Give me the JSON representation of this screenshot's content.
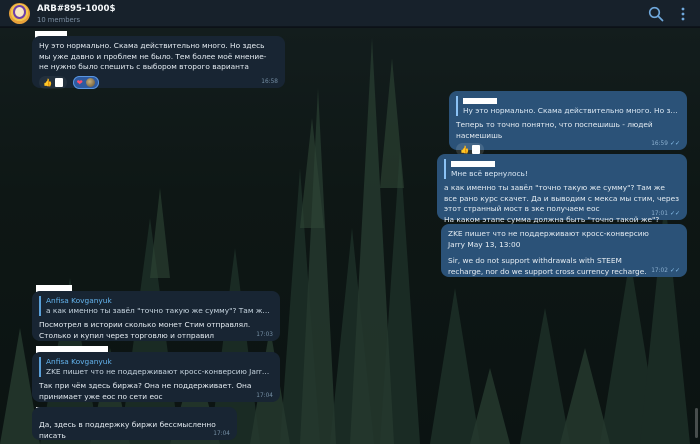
{
  "header": {
    "title": "ARB#895-1000$",
    "members": "10 members"
  },
  "colors": {
    "header_bg": "#17212b",
    "incoming_bubble": "#182533",
    "outgoing_bubble": "#2b5278",
    "quote_accent": "#64b5ef"
  },
  "icons": {
    "search": "search-icon",
    "more": "more-vertical-icon"
  },
  "messages": [
    {
      "direction": "in",
      "text": "Ну это нормально. Скама действительно много. Но здесь мы уже давно и проблем не было. Тем более моё мнение- не нужно было спешить с выбором второго варианта",
      "time": "16:58",
      "reactions": [
        "👍",
        "❤"
      ]
    },
    {
      "direction": "out",
      "quote_text": "Ну это нормально. Скама действительно много. Но здесь мы...",
      "text": "Теперь то точно понятно, что поспешишь - людей насмешишь",
      "time": "16:59",
      "reactions": [
        "👍"
      ]
    },
    {
      "direction": "out",
      "quote_text": "Мне всё вернулось!",
      "text": "а как именно ты завёл \"точно такую же сумму\"? Там же все рано курс скачет. Да и выводим с мекса мы стим, через этот странный мост в зке получаем еос",
      "text2": "На каком этапе сумма должна быть \"точно такой же\"?",
      "time": "17:01"
    },
    {
      "direction": "out",
      "text": "ZKE пишет что не поддерживают кросс-конверсию",
      "text2": "Jarry May 13, 13:00",
      "text3": "Sir, we do not support withdrawals with STEEM recharge, nor do we support cross currency recharge.",
      "time": "17:02"
    },
    {
      "direction": "in",
      "quote_name": "Anfisa Kovganyuk",
      "quote_text": "а как именно ты завёл \"точно такую же сумму\"? Там же все ран...",
      "text": "Посмотрел в истории сколько монет Стим отправлял. Столько и купил через торговлю и отправил",
      "time": "17:03"
    },
    {
      "direction": "in",
      "quote_name": "Anfisa Kovganyuk",
      "quote_text": "ZKE пишет что не поддерживают кросс-конверсию Jarry May 13,...",
      "text": "Так при чём здесь биржа? Она не поддерживает. Она принимает уже еос по сети еос",
      "time": "17:04"
    },
    {
      "direction": "in",
      "text": "Да, здесь в поддержку биржи бессмысленно писать",
      "time": "17:04"
    }
  ]
}
